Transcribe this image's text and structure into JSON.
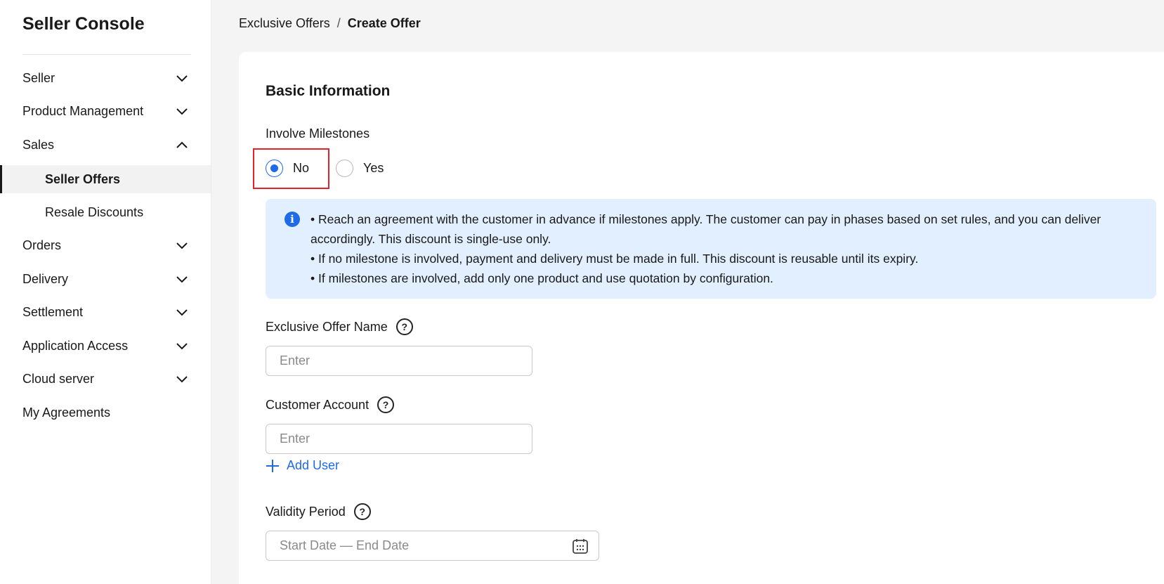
{
  "sidebar": {
    "title": "Seller Console",
    "items": [
      {
        "label": "Seller",
        "chevron": "down"
      },
      {
        "label": "Product Management",
        "chevron": "down"
      },
      {
        "label": "Sales",
        "chevron": "up"
      },
      {
        "label": "Seller Offers",
        "active": true
      },
      {
        "label": "Resale Discounts"
      },
      {
        "label": "Orders",
        "chevron": "down"
      },
      {
        "label": "Delivery",
        "chevron": "down"
      },
      {
        "label": "Settlement",
        "chevron": "down"
      },
      {
        "label": "Application Access",
        "chevron": "down"
      },
      {
        "label": "Cloud server",
        "chevron": "down"
      },
      {
        "label": "My Agreements"
      }
    ]
  },
  "breadcrumb": {
    "parent": "Exclusive Offers",
    "separator": "/",
    "current": "Create Offer"
  },
  "form": {
    "section_title": "Basic Information",
    "milestones": {
      "label": "Involve Milestones",
      "options": [
        "No",
        "Yes"
      ],
      "selected": "No"
    },
    "info": {
      "line1": "• Reach an agreement with the customer in advance if milestones apply. The customer can pay in phases based on set rules, and you can deliver accordingly. This discount is single-use only.",
      "line2": "• If no milestone is involved, payment and delivery must be made in full. This discount is reusable until its expiry.",
      "line3": "• If milestones are involved, add only one product and use quotation by configuration."
    },
    "offer_name": {
      "label": "Exclusive Offer Name",
      "placeholder": "Enter",
      "value": ""
    },
    "customer_account": {
      "label": "Customer Account",
      "placeholder": "Enter",
      "value": ""
    },
    "add_user_label": "Add User",
    "validity": {
      "label": "Validity Period",
      "placeholder": "Start Date — End Date"
    }
  },
  "colors": {
    "accent": "#1f6ae6",
    "highlight": "#e0242a",
    "info_bg": "#e2efff"
  }
}
